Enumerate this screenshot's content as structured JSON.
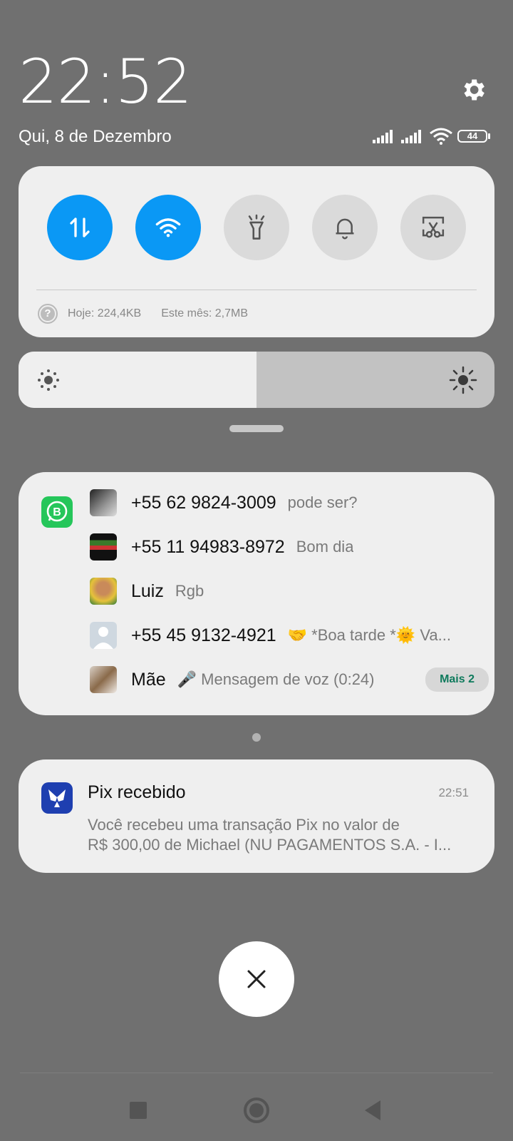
{
  "status": {
    "time": "22:52",
    "date": "Qui, 8 de Dezembro",
    "battery": "44"
  },
  "quick_settings": {
    "toggles": [
      {
        "name": "mobile-data",
        "state": "on"
      },
      {
        "name": "wifi",
        "state": "on"
      },
      {
        "name": "flashlight",
        "state": "off"
      },
      {
        "name": "sound",
        "state": "off"
      },
      {
        "name": "screenshot",
        "state": "off"
      }
    ],
    "usage_today": "Hoje: 224,4KB",
    "usage_month": "Este mês: 2,7MB"
  },
  "brightness": {
    "level": 0.5
  },
  "whatsapp": {
    "app_icon": "whatsapp-business-icon",
    "messages": [
      {
        "sender": "+55 62 9824-3009",
        "preview": "pode ser?"
      },
      {
        "sender": "+55 11 94983-8972",
        "preview": "Bom dia"
      },
      {
        "sender": "Luiz",
        "preview": "Rgb"
      },
      {
        "sender": "+55 45 9132-4921",
        "preview": "🤝 *Boa tarde  *🌞 Va..."
      },
      {
        "sender": "Mãe",
        "preview": "🎤 Mensagem de voz (0:24)"
      }
    ],
    "more_label": "Mais 2"
  },
  "pix": {
    "title": "Pix recebido",
    "time": "22:51",
    "line1": "Você recebeu uma transação Pix no valor de",
    "line2": "R$ 300,00 de Michael (NU PAGAMENTOS S.A. - I..."
  },
  "colors": {
    "accent": "#0a98f5",
    "background": "#707070",
    "card": "#efefef"
  }
}
